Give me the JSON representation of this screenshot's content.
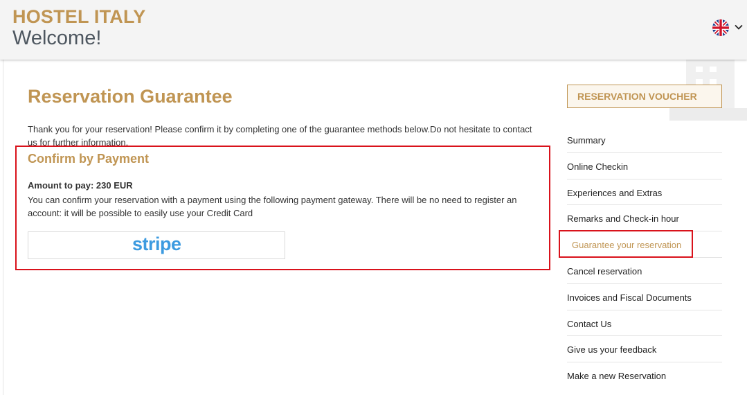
{
  "header": {
    "brand": "HOSTEL ITALY",
    "welcome": "Welcome!",
    "language_icon": "uk-flag-icon",
    "dropdown_icon": "chevron-down-icon"
  },
  "main": {
    "title": "Reservation Guarantee",
    "intro": "Thank you for your reservation! Please confirm it by completing one of the guarantee methods below.Do not hesitate to contact us for further information.",
    "payment": {
      "title": "Confirm by Payment",
      "amount": "Amount to pay: 230 EUR",
      "description": "You can confirm your reservation with a payment using the following payment gateway. There will be no need to register an account: it will be possible to easily use your Credit Card",
      "gateway_label": "stripe"
    }
  },
  "sidebar": {
    "voucher_label": "RESERVATION VOUCHER",
    "items": [
      {
        "label": "Summary"
      },
      {
        "label": "Online Checkin"
      },
      {
        "label": "Experiences and Extras"
      },
      {
        "label": "Remarks and Check-in hour"
      },
      {
        "label": "Guarantee your reservation"
      },
      {
        "label": "Cancel reservation"
      },
      {
        "label": "Invoices and Fiscal Documents"
      },
      {
        "label": "Contact Us"
      },
      {
        "label": "Give us your feedback"
      },
      {
        "label": "Make a new Reservation"
      }
    ]
  },
  "colors": {
    "accent": "#c09553",
    "highlight": "#d9121b",
    "stripe": "#3d9be0"
  }
}
